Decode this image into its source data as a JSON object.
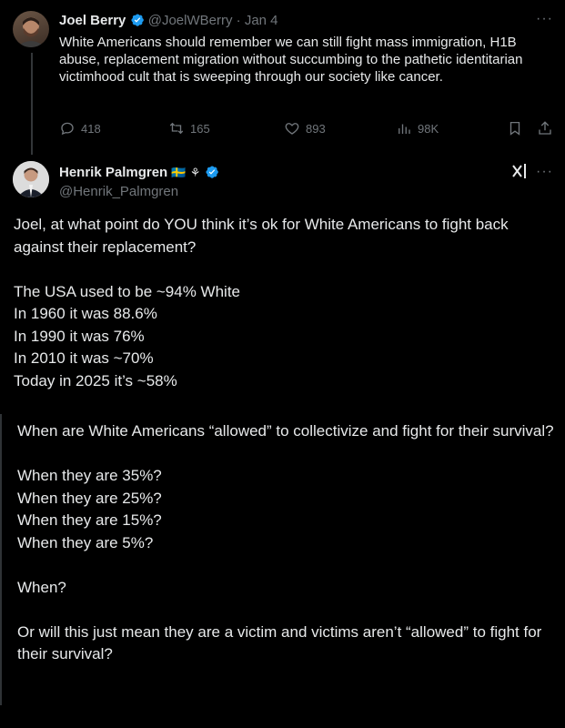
{
  "tweet1": {
    "name": "Joel Berry",
    "handle": "@JoelWBerry",
    "sep": "·",
    "date": "Jan 4",
    "text": "White Americans should remember we can still fight mass immigration, H1B abuse, replacement migration without succumbing to the pathetic identitarian victimhood cult that is sweeping through our society like cancer.",
    "replies": "418",
    "reposts": "165",
    "likes": "893",
    "views": "98K"
  },
  "tweet2": {
    "name": "Henrik Palmgren",
    "flag": "🇸🇪",
    "symbol": "⚘",
    "handle": "@Henrik_Palmgren",
    "text": "Joel, at what point do YOU think it’s ok for White Americans to fight back against their replacement?\n\nThe USA used to be ~94% White\nIn 1960 it was 88.6%\nIn 1990 it was 76%\nIn 2010 it was ~70%\nToday in 2025 it’s ~58%",
    "quote_text": "When are White Americans “allowed” to collectivize and fight for their survival?\n\nWhen they are 35%?\nWhen they are 25%?\nWhen they are 15%?\nWhen they are 5%?\n\nWhen?\n\nOr will this just mean they are a victim and victims aren’t “allowed” to fight for their survival?"
  },
  "icons": {
    "verified": "verified-badge-icon",
    "grok": "grok-icon",
    "more": "more-icon"
  },
  "colors": {
    "background": "#000000",
    "text": "#e7e9ea",
    "muted": "#71767b",
    "verified": "#1d9bf0"
  }
}
